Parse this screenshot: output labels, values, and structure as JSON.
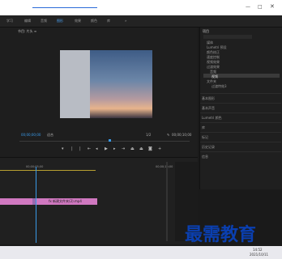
{
  "tabs": [
    "学习",
    "编辑",
    "音频",
    "图形",
    "效果",
    "颜色",
    "库",
    "»"
  ],
  "program_label": "节目: 片头 ≡",
  "timecode_left": "00;00;00;00",
  "fit": "适合",
  "ratio": "1/2",
  "timecode_right": "00;00;10;00",
  "ruler": [
    "00;00;05;00",
    "00;00;10;00"
  ],
  "clip_label": "fx 新建文件夹(2).mp4",
  "project_title": "项目",
  "project_items": [
    "媒体",
    "Lumetri 预设",
    "颜色校正",
    "速度控制",
    "视频效果",
    "过渡效果",
    "音频",
    "视频",
    "文件夹",
    "过渡特效3"
  ],
  "sections": [
    "基本图形",
    "基本声音",
    "Lumetri 颜色",
    "库",
    "标记",
    "历史记录",
    "信息"
  ],
  "watermark": "最需教育",
  "clock": "14:52",
  "date": "2021/10/11"
}
